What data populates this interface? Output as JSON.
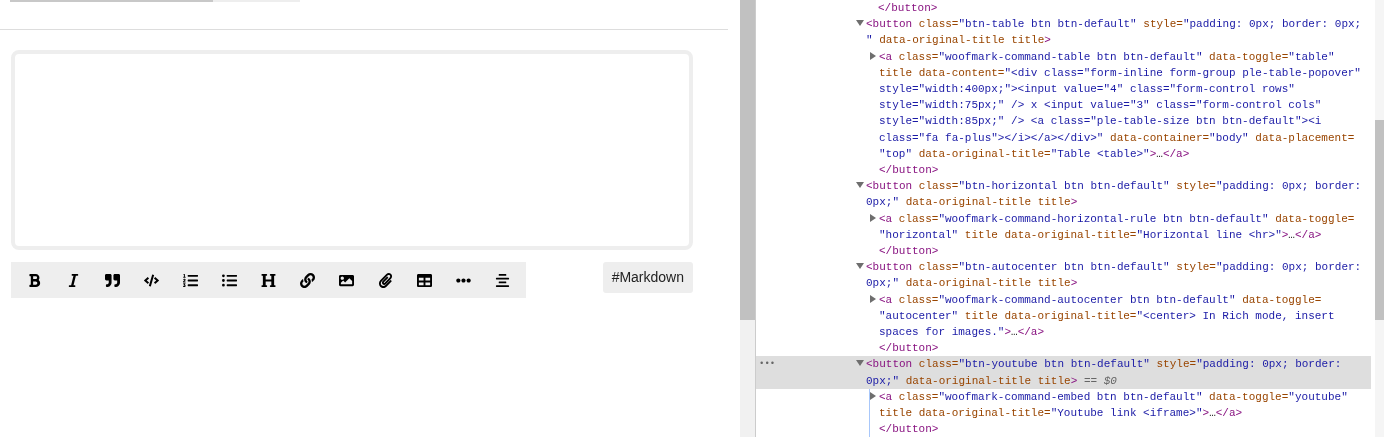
{
  "editor": {
    "top_bar": {
      "level": 0.7
    },
    "markdown_button": "#Markdown"
  },
  "devtools": {
    "gutter_marker": "•••",
    "leading_close": [
      {
        "kind": "tag",
        "text": "</button>"
      }
    ],
    "nodes": [
      {
        "expanded": true,
        "selected": false,
        "open": [
          {
            "kind": "tag",
            "text": "<button"
          },
          {
            "kind": "attr",
            "text": " class="
          },
          {
            "kind": "value",
            "text": "\"btn-table btn btn-default\""
          },
          {
            "kind": "attr",
            "text": " style="
          },
          {
            "kind": "value",
            "text": "\"padding: 0px; border: 0px; \""
          },
          {
            "kind": "attr",
            "text": " data-original-title title"
          },
          {
            "kind": "tag",
            "text": ">"
          }
        ],
        "children": [
          {
            "expanded": false,
            "open": [
              {
                "kind": "tag",
                "text": "<a"
              },
              {
                "kind": "attr",
                "text": " class="
              },
              {
                "kind": "value",
                "text": "\"woofmark-command-table btn btn-default\""
              },
              {
                "kind": "attr",
                "text": " data-toggle="
              },
              {
                "kind": "value",
                "text": "\"table\""
              },
              {
                "kind": "attr",
                "text": " title data-content="
              },
              {
                "kind": "value",
                "text": "\"<div class=\"form-inline form-group ple-table-popover\" style=\"width:400px;\"><input value=\"4\" class=\"form-control rows\" style=\"width:75px;\" /> x <input value=\"3\" class=\"form-control cols\" style=\"width:85px;\" /> <a class=\"ple-table-size btn btn-default\"><i class=\"fa fa-plus\"></i></a></div>\""
              },
              {
                "kind": "attr",
                "text": " data-container="
              },
              {
                "kind": "value",
                "text": "\"body\""
              },
              {
                "kind": "attr",
                "text": " data-placement="
              },
              {
                "kind": "value",
                "text": "\"top\""
              },
              {
                "kind": "attr",
                "text": " data-original-title="
              },
              {
                "kind": "value",
                "text": "\"Table <table>\""
              },
              {
                "kind": "tag",
                "text": ">"
              },
              {
                "kind": "text",
                "text": "…"
              },
              {
                "kind": "tag",
                "text": "</a>"
              }
            ]
          }
        ],
        "close": [
          {
            "kind": "tag",
            "text": "</button>"
          }
        ]
      },
      {
        "expanded": true,
        "selected": false,
        "open": [
          {
            "kind": "tag",
            "text": "<button"
          },
          {
            "kind": "attr",
            "text": " class="
          },
          {
            "kind": "value",
            "text": "\"btn-horizontal btn btn-default\""
          },
          {
            "kind": "attr",
            "text": " style="
          },
          {
            "kind": "value",
            "text": "\"padding: 0px; border: 0px;\""
          },
          {
            "kind": "attr",
            "text": " data-original-title title"
          },
          {
            "kind": "tag",
            "text": ">"
          }
        ],
        "children": [
          {
            "expanded": false,
            "open": [
              {
                "kind": "tag",
                "text": "<a"
              },
              {
                "kind": "attr",
                "text": " class="
              },
              {
                "kind": "value",
                "text": "\"woofmark-command-horizontal-rule btn btn-default\""
              },
              {
                "kind": "attr",
                "text": " data-toggle="
              },
              {
                "kind": "value",
                "text": "\"horizontal\""
              },
              {
                "kind": "attr",
                "text": " title data-original-title="
              },
              {
                "kind": "value",
                "text": "\"Horizontal line <hr>\""
              },
              {
                "kind": "tag",
                "text": ">"
              },
              {
                "kind": "text",
                "text": "…"
              },
              {
                "kind": "tag",
                "text": "</a>"
              }
            ]
          }
        ],
        "close": [
          {
            "kind": "tag",
            "text": "</button>"
          }
        ]
      },
      {
        "expanded": true,
        "selected": false,
        "open": [
          {
            "kind": "tag",
            "text": "<button"
          },
          {
            "kind": "attr",
            "text": " class="
          },
          {
            "kind": "value",
            "text": "\"btn-autocenter btn btn-default\""
          },
          {
            "kind": "attr",
            "text": " style="
          },
          {
            "kind": "value",
            "text": "\"padding: 0px; border: 0px;\""
          },
          {
            "kind": "attr",
            "text": " data-original-title title"
          },
          {
            "kind": "tag",
            "text": ">"
          }
        ],
        "children": [
          {
            "expanded": false,
            "open": [
              {
                "kind": "tag",
                "text": "<a"
              },
              {
                "kind": "attr",
                "text": " class="
              },
              {
                "kind": "value",
                "text": "\"woofmark-command-autocenter btn btn-default\""
              },
              {
                "kind": "attr",
                "text": " data-toggle="
              },
              {
                "kind": "value",
                "text": "\"autocenter\""
              },
              {
                "kind": "attr",
                "text": " title data-original-title="
              },
              {
                "kind": "value",
                "text": "\"<center> In Rich mode, insert spaces for images.\""
              },
              {
                "kind": "tag",
                "text": ">"
              },
              {
                "kind": "text",
                "text": "…"
              },
              {
                "kind": "tag",
                "text": "</a>"
              }
            ]
          }
        ],
        "close": [
          {
            "kind": "tag",
            "text": "</button>"
          }
        ]
      },
      {
        "expanded": true,
        "selected": true,
        "open": [
          {
            "kind": "tag",
            "text": "<button"
          },
          {
            "kind": "attr",
            "text": " class="
          },
          {
            "kind": "value",
            "text": "\"btn-youtube btn btn-default\""
          },
          {
            "kind": "attr",
            "text": " style="
          },
          {
            "kind": "value",
            "text": "\"padding: 0px; border: 0px;\""
          },
          {
            "kind": "attr",
            "text": " data-original-title title"
          },
          {
            "kind": "tag",
            "text": ">"
          },
          {
            "kind": "ref",
            "text": " == $0"
          }
        ],
        "children": [
          {
            "expanded": false,
            "open": [
              {
                "kind": "tag",
                "text": "<a"
              },
              {
                "kind": "attr",
                "text": " class="
              },
              {
                "kind": "value",
                "text": "\"woofmark-command-embed btn btn-default\""
              },
              {
                "kind": "attr",
                "text": " data-toggle="
              },
              {
                "kind": "value",
                "text": "\"youtube\""
              },
              {
                "kind": "attr",
                "text": " title data-original-title="
              },
              {
                "kind": "value",
                "text": "\"Youtube link <iframe>\""
              },
              {
                "kind": "tag",
                "text": ">"
              },
              {
                "kind": "text",
                "text": "…"
              },
              {
                "kind": "tag",
                "text": "</a>"
              }
            ]
          }
        ],
        "close": [
          {
            "kind": "tag",
            "text": "</button>"
          }
        ]
      }
    ]
  }
}
